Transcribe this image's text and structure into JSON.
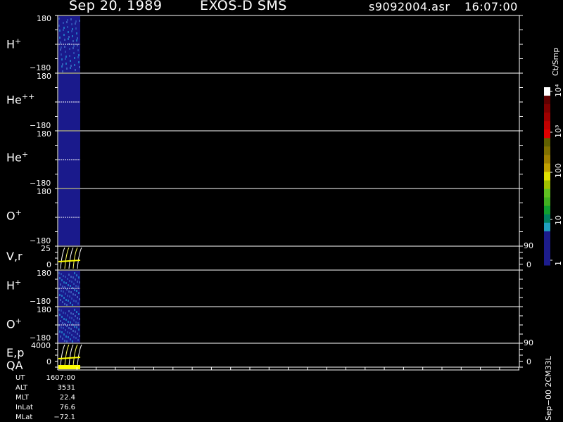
{
  "header": {
    "date": "Sep 20, 1989",
    "instrument": "EXOS-D SMS",
    "file": "s9092004.asr",
    "time": "16:07:00"
  },
  "panels": [
    {
      "key": "h1",
      "label": "H",
      "sup": "+",
      "ymax": "180",
      "ymin": "−180",
      "kind": "spec"
    },
    {
      "key": "hepp",
      "label": "He",
      "sup": "++",
      "ymax": "180",
      "ymin": "−180",
      "kind": "spec"
    },
    {
      "key": "hep",
      "label": "He",
      "sup": "+",
      "ymax": "180",
      "ymin": "−180",
      "kind": "spec"
    },
    {
      "key": "o1",
      "label": "O",
      "sup": "+",
      "ymax": "180",
      "ymin": "−180",
      "kind": "spec"
    },
    {
      "key": "vr",
      "label": "V,r",
      "sup": "",
      "ymax": "25",
      "ymin": "0",
      "kind": "line",
      "rmax": "90",
      "rmin": "0"
    },
    {
      "key": "h2",
      "label": "H",
      "sup": "+",
      "ymax": "180",
      "ymin": "−180",
      "kind": "spec"
    },
    {
      "key": "o2",
      "label": "O",
      "sup": "+",
      "ymax": "180",
      "ymin": "−180",
      "kind": "spec"
    },
    {
      "key": "ep",
      "label": "E,p",
      "sup": "",
      "ymax": "4000",
      "ymin": "0",
      "kind": "line",
      "rmax": "90",
      "rmin": "0"
    }
  ],
  "qa_label": "QA",
  "colorbar": {
    "unit": "Ct/Smp",
    "tick_labels": [
      "1",
      "10",
      "100",
      "10³",
      "10⁴"
    ],
    "colors": [
      "#1c1c8c",
      "#1c1c8c",
      "#1c1c8c",
      "#1c1c8c",
      "#20a0c0",
      "#008060",
      "#10a030",
      "#40b020",
      "#60c020",
      "#a0c000",
      "#e0e000",
      "#c0a000",
      "#a08000",
      "#807000",
      "#606000",
      "#e00000",
      "#c00000",
      "#a00000",
      "#800000",
      "#600000",
      "#ffffff"
    ]
  },
  "ephemeris": [
    {
      "key": "UT",
      "value": "1607:00"
    },
    {
      "key": "ALT",
      "value": "3531"
    },
    {
      "key": "MLT",
      "value": "22.4"
    },
    {
      "key": "InLat",
      "value": "76.6"
    },
    {
      "key": "MLat",
      "value": "−72.1"
    }
  ],
  "footer_code": "Sep−00 2CM33L",
  "chart_data": {
    "type": "heatmap",
    "title": "Sep 20, 1989   EXOS-D SMS",
    "x_range": [
      "16:07:00",
      "16:07:00"
    ],
    "series": [
      {
        "name": "H+",
        "y_range": [
          -180,
          180
        ]
      },
      {
        "name": "He++",
        "y_range": [
          -180,
          180
        ]
      },
      {
        "name": "He+",
        "y_range": [
          -180,
          180
        ]
      },
      {
        "name": "O+",
        "y_range": [
          -180,
          180
        ]
      },
      {
        "name": "V,r",
        "y_range": [
          0,
          25
        ],
        "right_range": [
          0,
          90
        ]
      },
      {
        "name": "H+",
        "y_range": [
          -180,
          180
        ]
      },
      {
        "name": "O+",
        "y_range": [
          -180,
          180
        ]
      },
      {
        "name": "E,p",
        "y_range": [
          0,
          4000
        ],
        "right_range": [
          0,
          90
        ]
      }
    ],
    "colorbar_unit": "Ct/Smp",
    "colorbar_ticks": [
      "1",
      "10",
      "100",
      "10³",
      "10⁴"
    ]
  }
}
